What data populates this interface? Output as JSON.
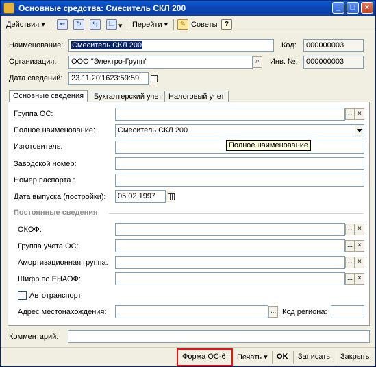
{
  "window": {
    "title": "Основные средства: Смеситель СКЛ 200",
    "min": "_",
    "max": "□",
    "close": "×"
  },
  "toolbar": {
    "actions": "Действия",
    "goto": "Перейти",
    "tips": "Советы",
    "help": "?"
  },
  "header": {
    "name_label": "Наименование:",
    "name_value": "Смеситель СКЛ 200",
    "code_label": "Код:",
    "code_value": "000000003",
    "org_label": "Организация:",
    "org_value": "ООО \"Электро-Групп\"",
    "inv_label": "Инв. №:",
    "inv_value": "000000003",
    "date_label": "Дата сведений:",
    "date_value": "23.11.20'1623:59:59"
  },
  "tabs": [
    "Основные сведения",
    "Бухгалтерский учет",
    "Налоговый учет"
  ],
  "main": {
    "group_os_label": "Группа ОС:",
    "full_name_label": "Полное наименование:",
    "full_name_value": "Смеситель СКЛ 200",
    "tooltip": "Полное наименование",
    "maker_label": "Изготовитель:",
    "serial_label": "Заводской номер:",
    "passport_label": "Номер паспорта :",
    "release_label": "Дата выпуска (постройки):",
    "release_value": "05.02.1997",
    "permanent_title": "Постоянные сведения",
    "okof_label": "ОКОФ:",
    "acc_group_label": "Группа учета ОС:",
    "amort_label": "Амортизационная группа:",
    "cipher_label": "Шифр по ЕНАОФ:",
    "auto_label": "Автотранспорт",
    "address_label": "Адрес местонахождения:",
    "region_label": "Код региона:"
  },
  "comment_label": "Комментарий:",
  "buttons": {
    "form": "Форма ОС-6",
    "print": "Печать",
    "ok": "OK",
    "save": "Записать",
    "close": "Закрыть"
  },
  "icons": {
    "dots": "...",
    "clear": "×",
    "search": "⌕",
    "dropdown": "▾"
  },
  "colors": {
    "title_bar": "#0a46b8",
    "highlight": "#0a246a",
    "red_frame": "#e11111"
  }
}
